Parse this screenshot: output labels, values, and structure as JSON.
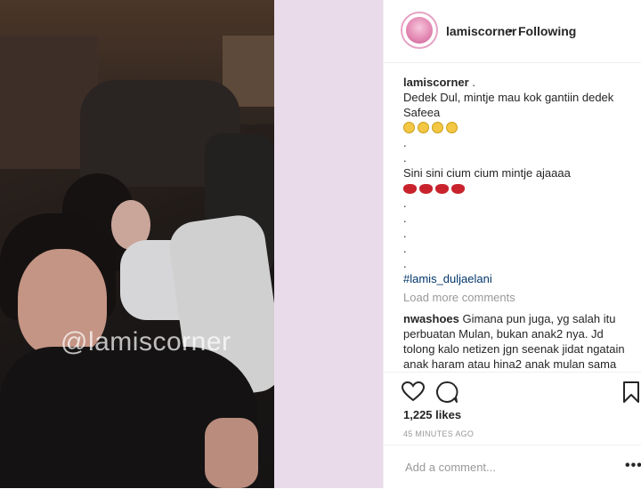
{
  "post": {
    "video_watermark": "@lamiscorner"
  },
  "header": {
    "username": "lamiscorner",
    "separator": "•",
    "follow_status": "Following"
  },
  "caption": {
    "username": "lamiscorner",
    "first_text": ".",
    "line1": "Dedek Dul, mintje mau kok gantiin dedek",
    "line2": "Safeea",
    "emoji_row1_icon": "grinning-face-icon",
    "dot1": ".",
    "dot2": ".",
    "line3": "Sini sini cium cium mintje ajaaaa",
    "emoji_row2_icon": "lips-icon",
    "dot3": ".",
    "dot4": ".",
    "dot5": ".",
    "dot6": ".",
    "dot7": ".",
    "hashtag": "#lamis_duljaelani"
  },
  "load_more": "Load more comments",
  "comment1": {
    "username": "nwashoes",
    "text": "Gimana pun juga, yg salah itu perbuatan Mulan, bukan anak2 nya. Jd tolong kalo netizen jgn seenak jidat ngatain anak haram atau hina2 anak mulan sama"
  },
  "stats": {
    "likes": "1,225 likes",
    "time": "45 MINUTES AGO"
  },
  "add_comment": {
    "placeholder": "Add a comment..."
  },
  "more_options": "•••",
  "colors": {
    "accent_link": "#003569",
    "muted": "#999999",
    "text": "#262626",
    "background_side": "#e9dbea"
  }
}
